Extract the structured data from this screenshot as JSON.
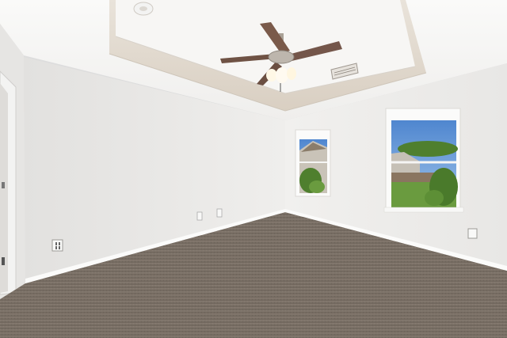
{
  "photo": {
    "subject": "empty-room-with-tray-ceiling",
    "colors": {
      "wall_left": "#eceae8",
      "wall_right": "#f2f1ef",
      "ceiling": "#f6f5f3",
      "tray_band": "#e4ddd3",
      "carpet": "#7b7168",
      "baseboard": "#f8f8f6",
      "fan_blade": "#7a5a4a",
      "fan_metal": "#bdb6ad",
      "sky": "#5a8fd0",
      "grass": "#6a9b3f",
      "trees": "#4f7f2e"
    },
    "objects": [
      "ceiling-fan",
      "smoke-detector",
      "air-vent",
      "window-left",
      "window-right",
      "doorway",
      "electrical-outlet"
    ]
  }
}
